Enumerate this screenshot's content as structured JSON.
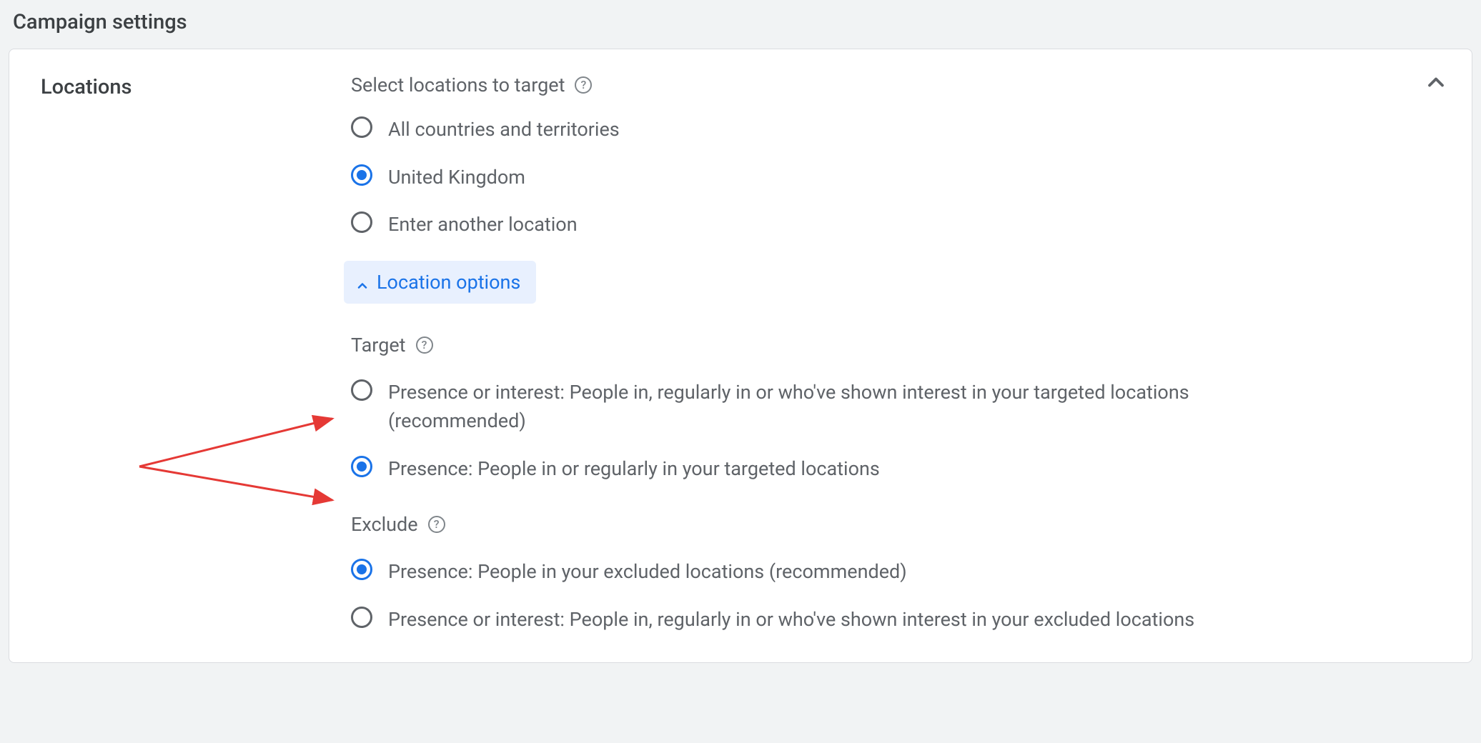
{
  "page_title": "Campaign settings",
  "section": {
    "label": "Locations",
    "subheading": "Select locations to target",
    "radios": [
      {
        "label": "All countries and territories",
        "selected": false
      },
      {
        "label": "United Kingdom",
        "selected": true
      },
      {
        "label": "Enter another location",
        "selected": false
      }
    ],
    "location_options_label": "Location options",
    "target": {
      "title": "Target",
      "options": [
        {
          "label": "Presence or interest: People in, regularly in or who've shown interest in your targeted locations (recommended)",
          "selected": false
        },
        {
          "label": "Presence: People in or regularly in your targeted locations",
          "selected": true
        }
      ]
    },
    "exclude": {
      "title": "Exclude",
      "options": [
        {
          "label": "Presence: People in your excluded locations (recommended)",
          "selected": true
        },
        {
          "label": "Presence or interest: People in, regularly in or who've shown interest in your excluded locations",
          "selected": false
        }
      ]
    }
  }
}
